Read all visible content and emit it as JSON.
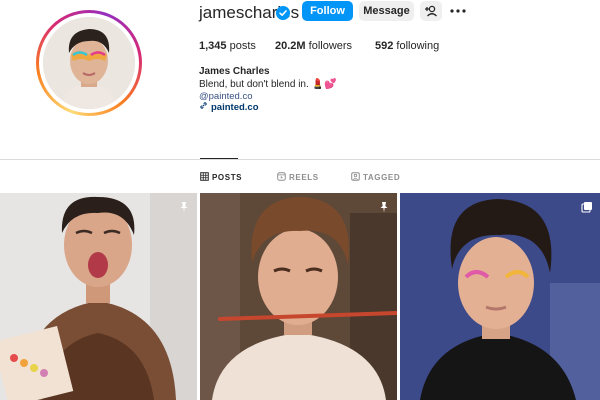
{
  "profile": {
    "username": "jamescharles",
    "full_name": "James Charles",
    "bio": "Blend, but don't blend in. 💄💕",
    "mention": "@painted.co",
    "link": "painted.co",
    "verified": true
  },
  "actions": {
    "follow_label": "Follow",
    "message_label": "Message"
  },
  "stats": {
    "posts_count": "1,345",
    "posts_label": "posts",
    "followers_count": "20.2M",
    "followers_label": "followers",
    "following_count": "592",
    "following_label": "following"
  },
  "tabs": [
    {
      "label": "POSTS",
      "icon": "grid-icon",
      "active": true
    },
    {
      "label": "REELS",
      "icon": "reels-icon",
      "active": false
    },
    {
      "label": "TAGGED",
      "icon": "tagged-icon",
      "active": false
    }
  ],
  "posts": [
    {
      "badge": "pin-icon"
    },
    {
      "badge": "pin-icon"
    },
    {
      "badge": "carousel-icon"
    }
  ],
  "colors": {
    "accent": "#0095f6",
    "link": "#00376b",
    "secondary_button": "#efefef",
    "muted_text": "#8e8e8e"
  }
}
